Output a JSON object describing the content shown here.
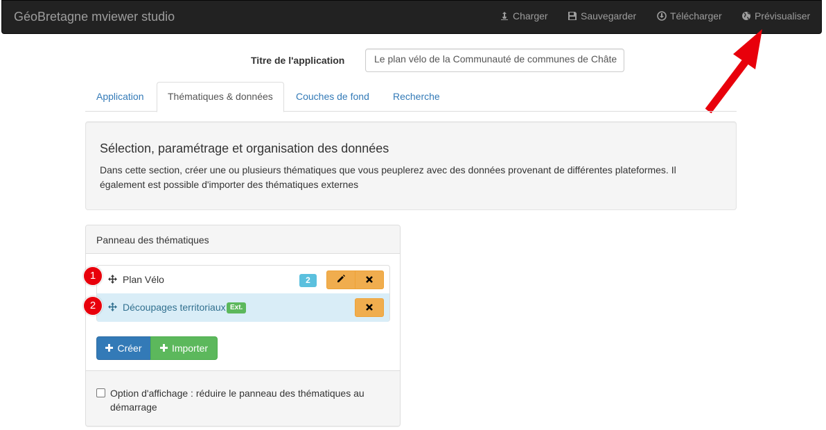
{
  "navbar": {
    "brand": "GéoBretagne mviewer studio",
    "items": [
      {
        "label": "Charger",
        "icon": "open-icon"
      },
      {
        "label": "Sauvegarder",
        "icon": "save-icon"
      },
      {
        "label": "Télécharger",
        "icon": "download-icon"
      },
      {
        "label": "Prévisualiser",
        "icon": "globe-icon"
      }
    ]
  },
  "app_title": {
    "label": "Titre de l'application",
    "value": "Le plan vélo de la Communauté de communes de Châte"
  },
  "tabs": [
    {
      "label": "Application",
      "active": false
    },
    {
      "label": "Thématiques & données",
      "active": true
    },
    {
      "label": "Couches de fond",
      "active": false
    },
    {
      "label": "Recherche",
      "active": false
    }
  ],
  "section": {
    "heading": "Sélection, paramétrage et organisation des données",
    "description": "Dans cette section, créer une ou plusieurs thématiques que vous peuplerez avec des données provenant de différentes plateformes. Il également est possible d'importer des thématiques externes"
  },
  "panel": {
    "title": "Panneau des thématiques",
    "themes": [
      {
        "marker": "1",
        "label": "Plan Vélo",
        "count": "2"
      },
      {
        "marker": "2",
        "label": "Découpages territoriaux",
        "badge": "Ext."
      }
    ],
    "create_label": "Créer",
    "import_label": "Importer",
    "option_label": "Option d'affichage : réduire le panneau des thématiques au démarrage"
  },
  "colors": {
    "navbar": "#222222",
    "primary": "#337ab7",
    "success": "#5cb85c",
    "warning": "#f0ad4e",
    "info": "#5bc0de",
    "annotation": "#e8000b"
  }
}
